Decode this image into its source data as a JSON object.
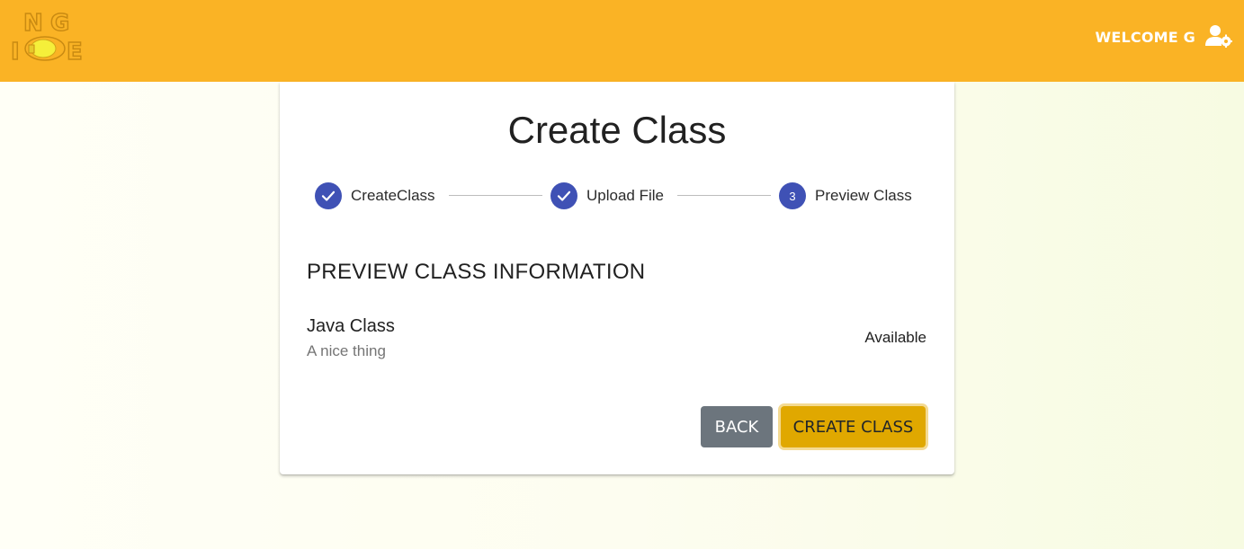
{
  "header": {
    "welcome_text": "WELCOME G",
    "logo_icon": "ng-ide-lightbulb-logo",
    "user_icon": "user-settings-icon",
    "brand_color": "#fab325"
  },
  "page": {
    "title": "Create Class"
  },
  "stepper": {
    "steps": [
      {
        "label": "CreateClass",
        "state": "completed",
        "icon": "check-icon"
      },
      {
        "label": "Upload File",
        "state": "completed",
        "icon": "check-icon"
      },
      {
        "label": "Preview Class",
        "state": "active",
        "number": "3"
      }
    ],
    "accent_color": "#3f51b5"
  },
  "preview": {
    "heading": "PREVIEW CLASS INFORMATION",
    "class_name": "Java Class",
    "class_description": "A nice thing",
    "status": "Available"
  },
  "actions": {
    "back_label": "BACK",
    "create_label": "CREATE CLASS"
  }
}
